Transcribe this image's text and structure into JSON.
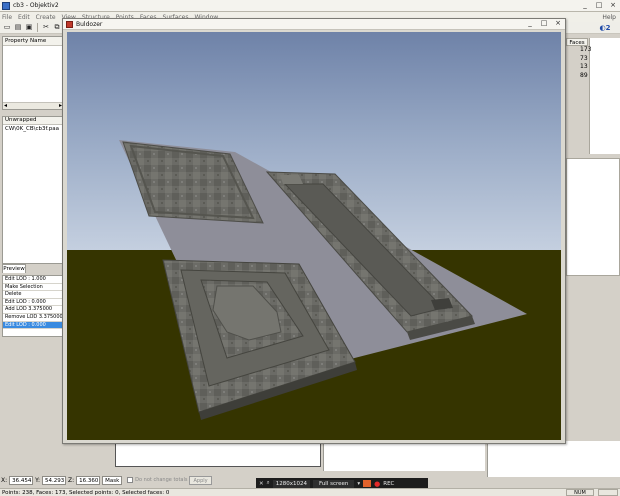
{
  "main_window": {
    "title": "cb3 - Objektiv2",
    "min": "_",
    "max": "□",
    "close": "×"
  },
  "menu": [
    "File",
    "Edit",
    "Create",
    "View",
    "Structure",
    "Points",
    "Faces",
    "Surfaces",
    "Window"
  ],
  "menu_help": "Help",
  "toolbar_icons": [
    "new-icon",
    "open-icon",
    "save-icon",
    "cut-icon",
    "copy-icon",
    "paste-icon",
    "undo-icon"
  ],
  "properties": {
    "header": "Property Name",
    "scroll_left": "◂",
    "scroll_right": "▸"
  },
  "textures": {
    "header": "Unwrapped",
    "items": [
      "CW\\0K_CB\\cb3f.paa"
    ]
  },
  "preview_tab": "Preview",
  "history": [
    "Edit LOD : 1.000",
    "Make Selection",
    "Delete",
    "Edit LOD : 0.000",
    "Add LOD 3.375000",
    "Remove LOD 3.375000",
    "Edit LOD : 0.000"
  ],
  "history_selected_index": 6,
  "faces": {
    "header": "Faces",
    "values": [
      "173",
      "73",
      "13",
      "89"
    ]
  },
  "buldozer": {
    "title": "Buldozer",
    "min": "_",
    "max": "□",
    "close": "×"
  },
  "coords": {
    "x_label": "X:",
    "x": "36.454",
    "y_label": "Y:",
    "y": "54.293",
    "z_label": "Z:",
    "z": "16.360",
    "mask_label": "Mask",
    "dont_change_label": "Do not change totals",
    "apply": "Apply"
  },
  "recorder": {
    "resolution": "1280x1024",
    "mode": "Full screen",
    "rec": "REC"
  },
  "status": {
    "text": "Points: 238, Faces: 173, Selected points: 0, Selected faces: 0",
    "num": "NUM"
  },
  "colors": {
    "sky_top": "#6e82a8",
    "sky_bottom": "#c5d0e0",
    "ground": "#353400",
    "plane": "#8e8e99",
    "stone": "#6b6b66",
    "highlight": "#3a8be0"
  }
}
